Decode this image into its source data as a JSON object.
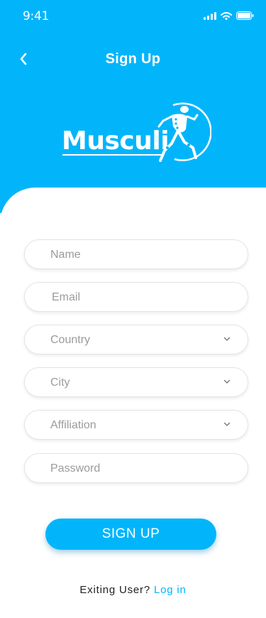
{
  "status_bar": {
    "time": "9:41"
  },
  "header": {
    "title": "Sign Up"
  },
  "logo": {
    "text": "Musculi"
  },
  "form": {
    "name_placeholder": "Name",
    "email_placeholder": "Email",
    "country_placeholder": "Country",
    "city_placeholder": "City",
    "affiliation_placeholder": "Affiliation",
    "password_placeholder": "Password"
  },
  "actions": {
    "signup_label": "SIGN UP"
  },
  "footer": {
    "question": "Exiting User?",
    "login_label": "Log in"
  },
  "colors": {
    "brand": "#02b5fb",
    "placeholder": "#9b9b9b",
    "border": "#e4e4e4"
  },
  "icons": [
    "back-chevron",
    "signal",
    "wifi",
    "battery",
    "dropdown-chevron",
    "runner-figure"
  ]
}
